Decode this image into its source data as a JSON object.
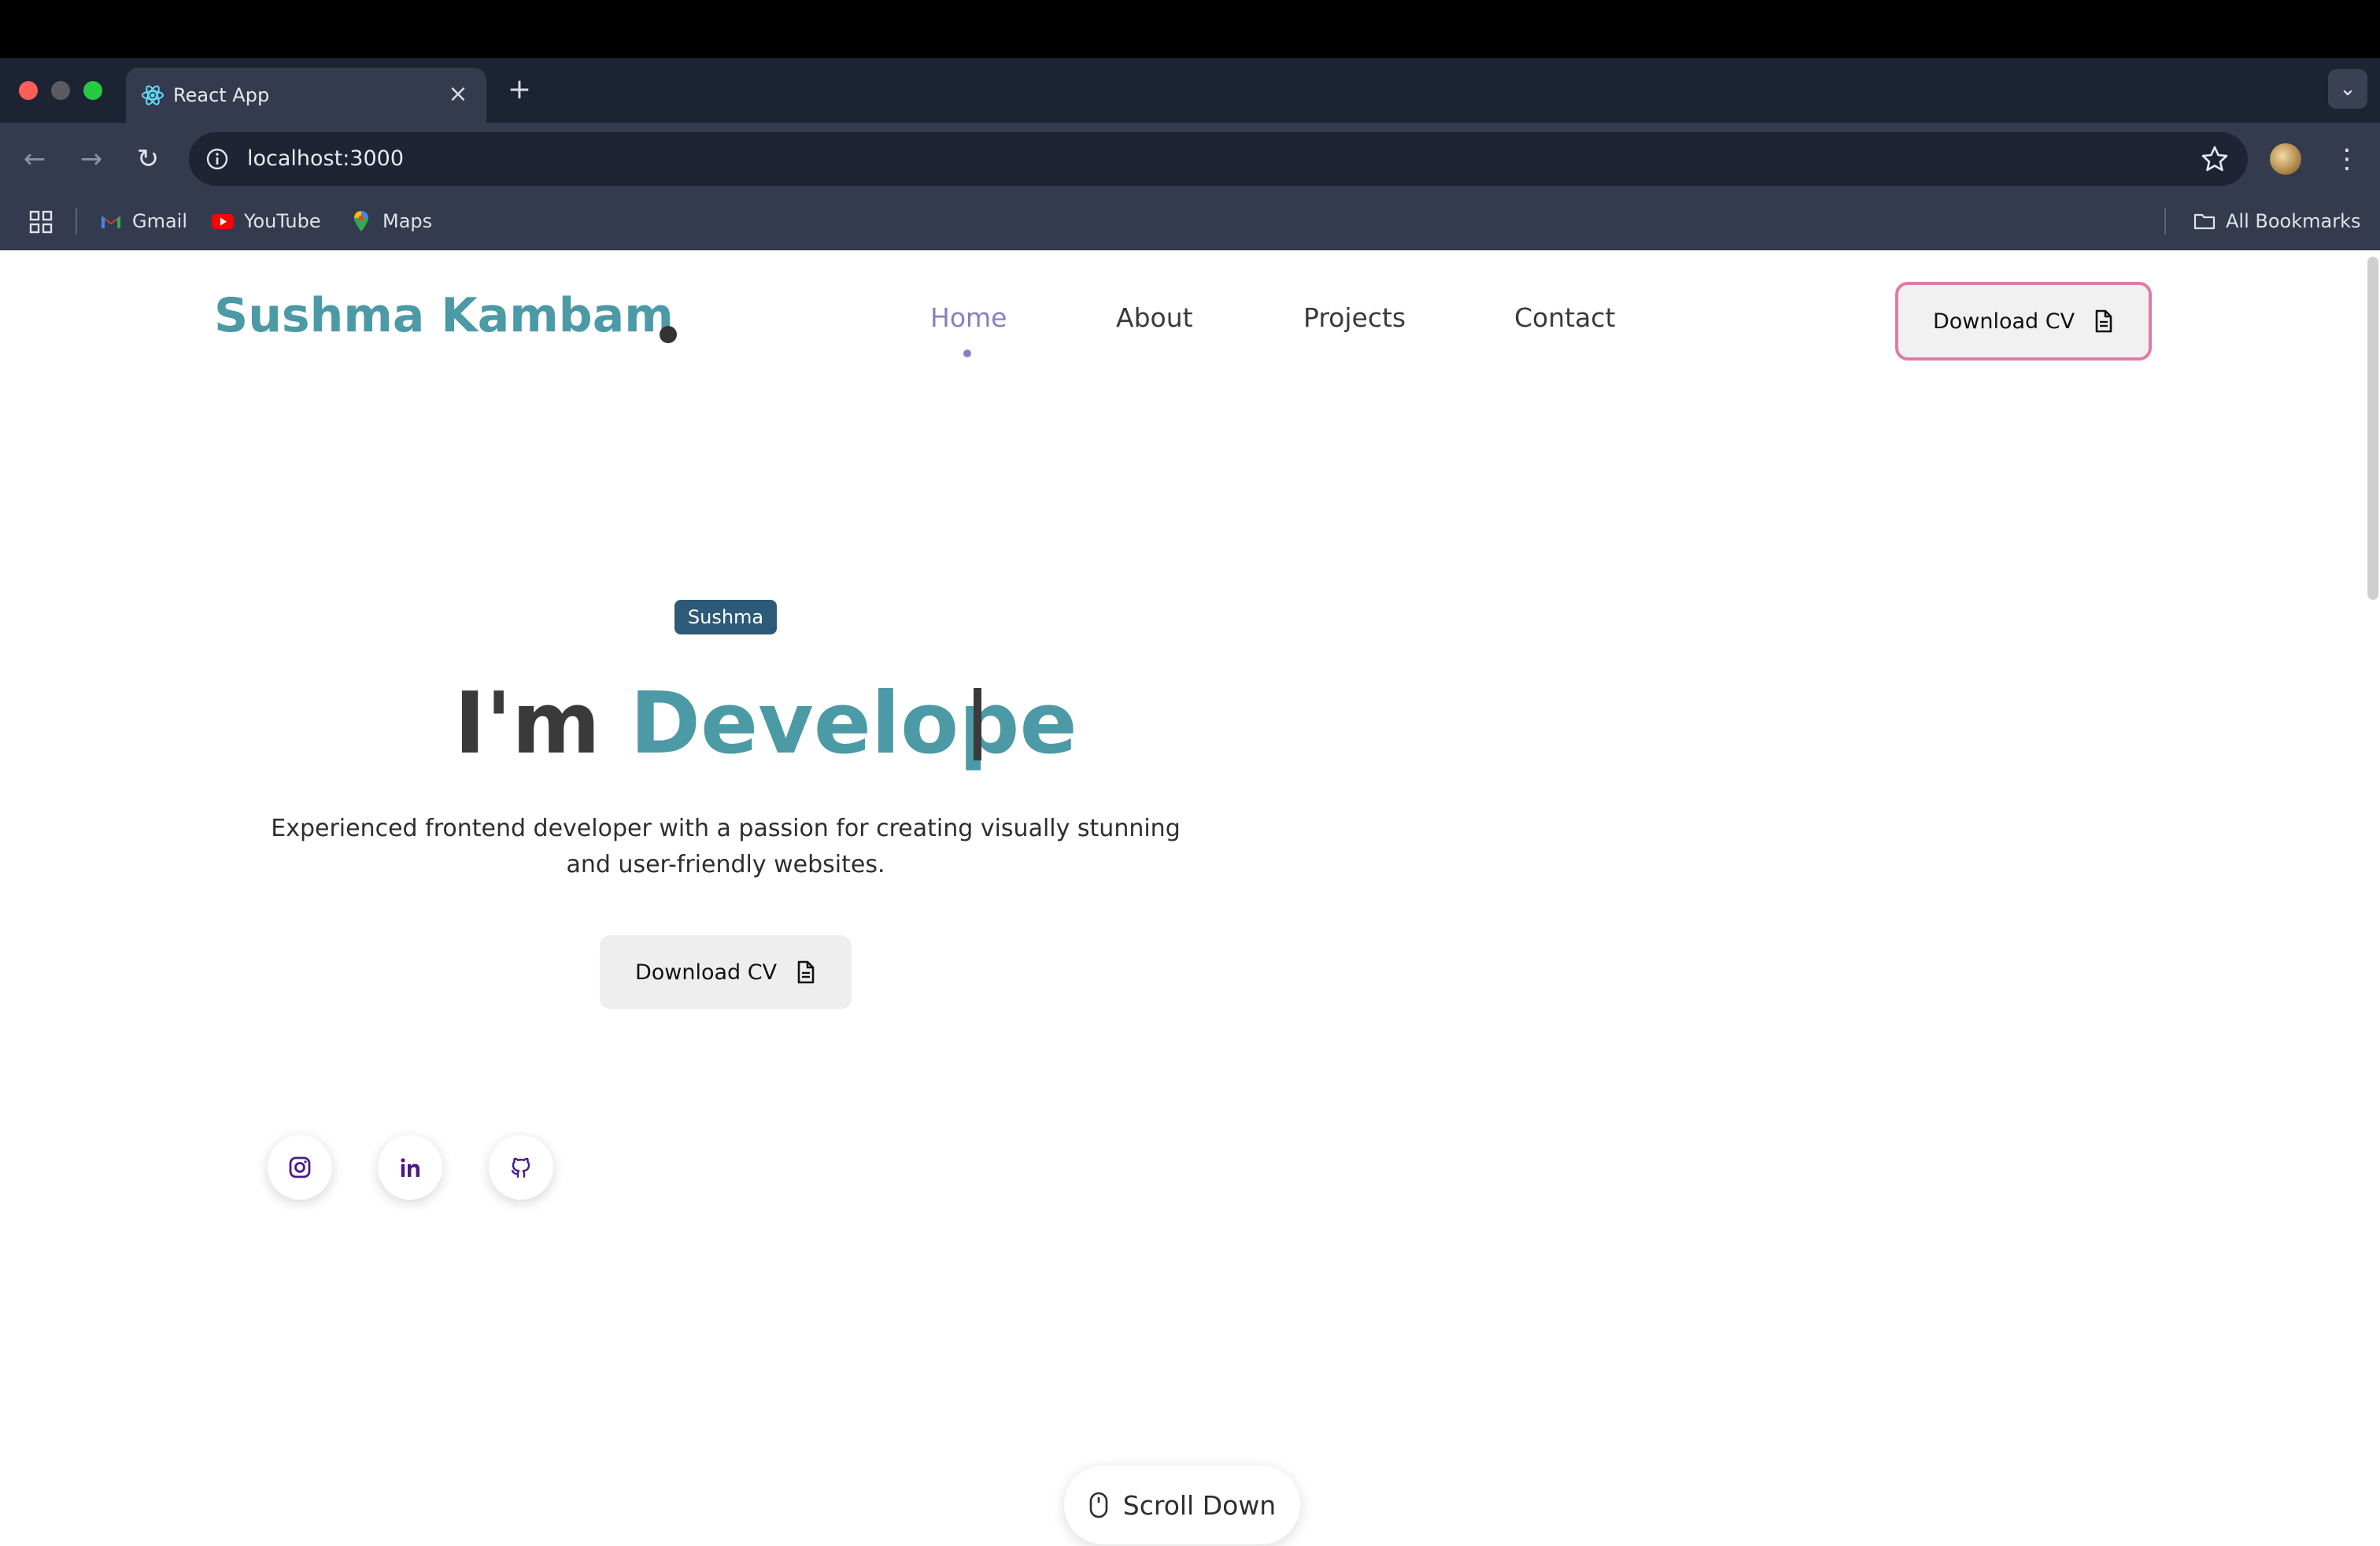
{
  "browser": {
    "tab": {
      "title": "React App",
      "favicon": "react-atom-icon"
    },
    "new_tab": "+",
    "url": "localhost:3000",
    "bookmarks": [
      {
        "label": "Gmail",
        "icon": "gmail-icon"
      },
      {
        "label": "YouTube",
        "icon": "youtube-icon"
      },
      {
        "label": "Maps",
        "icon": "maps-icon"
      }
    ],
    "all_bookmarks": "All Bookmarks"
  },
  "site": {
    "logo": "Sushma Kambam",
    "nav": [
      {
        "label": "Home",
        "active": true
      },
      {
        "label": "About",
        "active": false
      },
      {
        "label": "Projects",
        "active": false
      },
      {
        "label": "Contact",
        "active": false
      }
    ],
    "header_cv": "Download CV"
  },
  "hero": {
    "badge": "Sushma",
    "prefix": "I'm ",
    "typed": "Develope",
    "description": "Experienced frontend developer with a passion for creating visually stunning and user-friendly websites.",
    "cv_button": "Download CV"
  },
  "social": [
    {
      "icon": "instagram-icon"
    },
    {
      "icon": "linkedin-icon"
    },
    {
      "icon": "github-icon"
    }
  ],
  "scroll": "Scroll Down",
  "colors": {
    "accent": "#4b9aa6",
    "nav_active": "#8a7fc2",
    "badge_bg": "#2c5a78",
    "header_cv_border": "#e07aa8",
    "social_icon": "#4a1a8c"
  }
}
